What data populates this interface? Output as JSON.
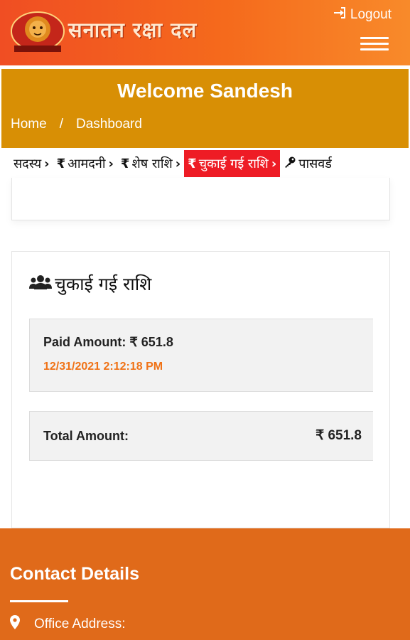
{
  "header": {
    "logo_text": "सनातन रक्षा दल",
    "logout_label": "Logout",
    "logout_icon": "sign-in-icon",
    "menu_icon": "hamburger-icon"
  },
  "welcome": {
    "title": "Welcome Sandesh",
    "breadcrumb": [
      "Home",
      "/",
      "Dashboard"
    ]
  },
  "tabs": [
    {
      "label": "सदस्य",
      "symbol": "",
      "active": false
    },
    {
      "label": "आमदनी",
      "symbol": "₹",
      "active": false
    },
    {
      "label": "शेष राशि",
      "symbol": "₹",
      "active": false
    },
    {
      "label": "चुकाई गई राशि",
      "symbol": "₹",
      "active": true
    },
    {
      "label": "पासवर्ड",
      "symbol": "key",
      "active": false
    }
  ],
  "main": {
    "title": "चुकाई गई राशि",
    "payment": {
      "label": "Paid Amount:",
      "amount": "₹ 651.8",
      "datetime": "12/31/2021 2:12:18 PM"
    },
    "total": {
      "label": "Total Amount:",
      "amount": "₹ 651.8"
    }
  },
  "footer": {
    "heading": "Contact Details",
    "office_label": "Office Address:"
  },
  "colors": {
    "header": "#f04e23",
    "welcome": "#d88f05",
    "active_tab": "#ee1c25",
    "date": "#f07216",
    "footer": "#e06a1a"
  }
}
